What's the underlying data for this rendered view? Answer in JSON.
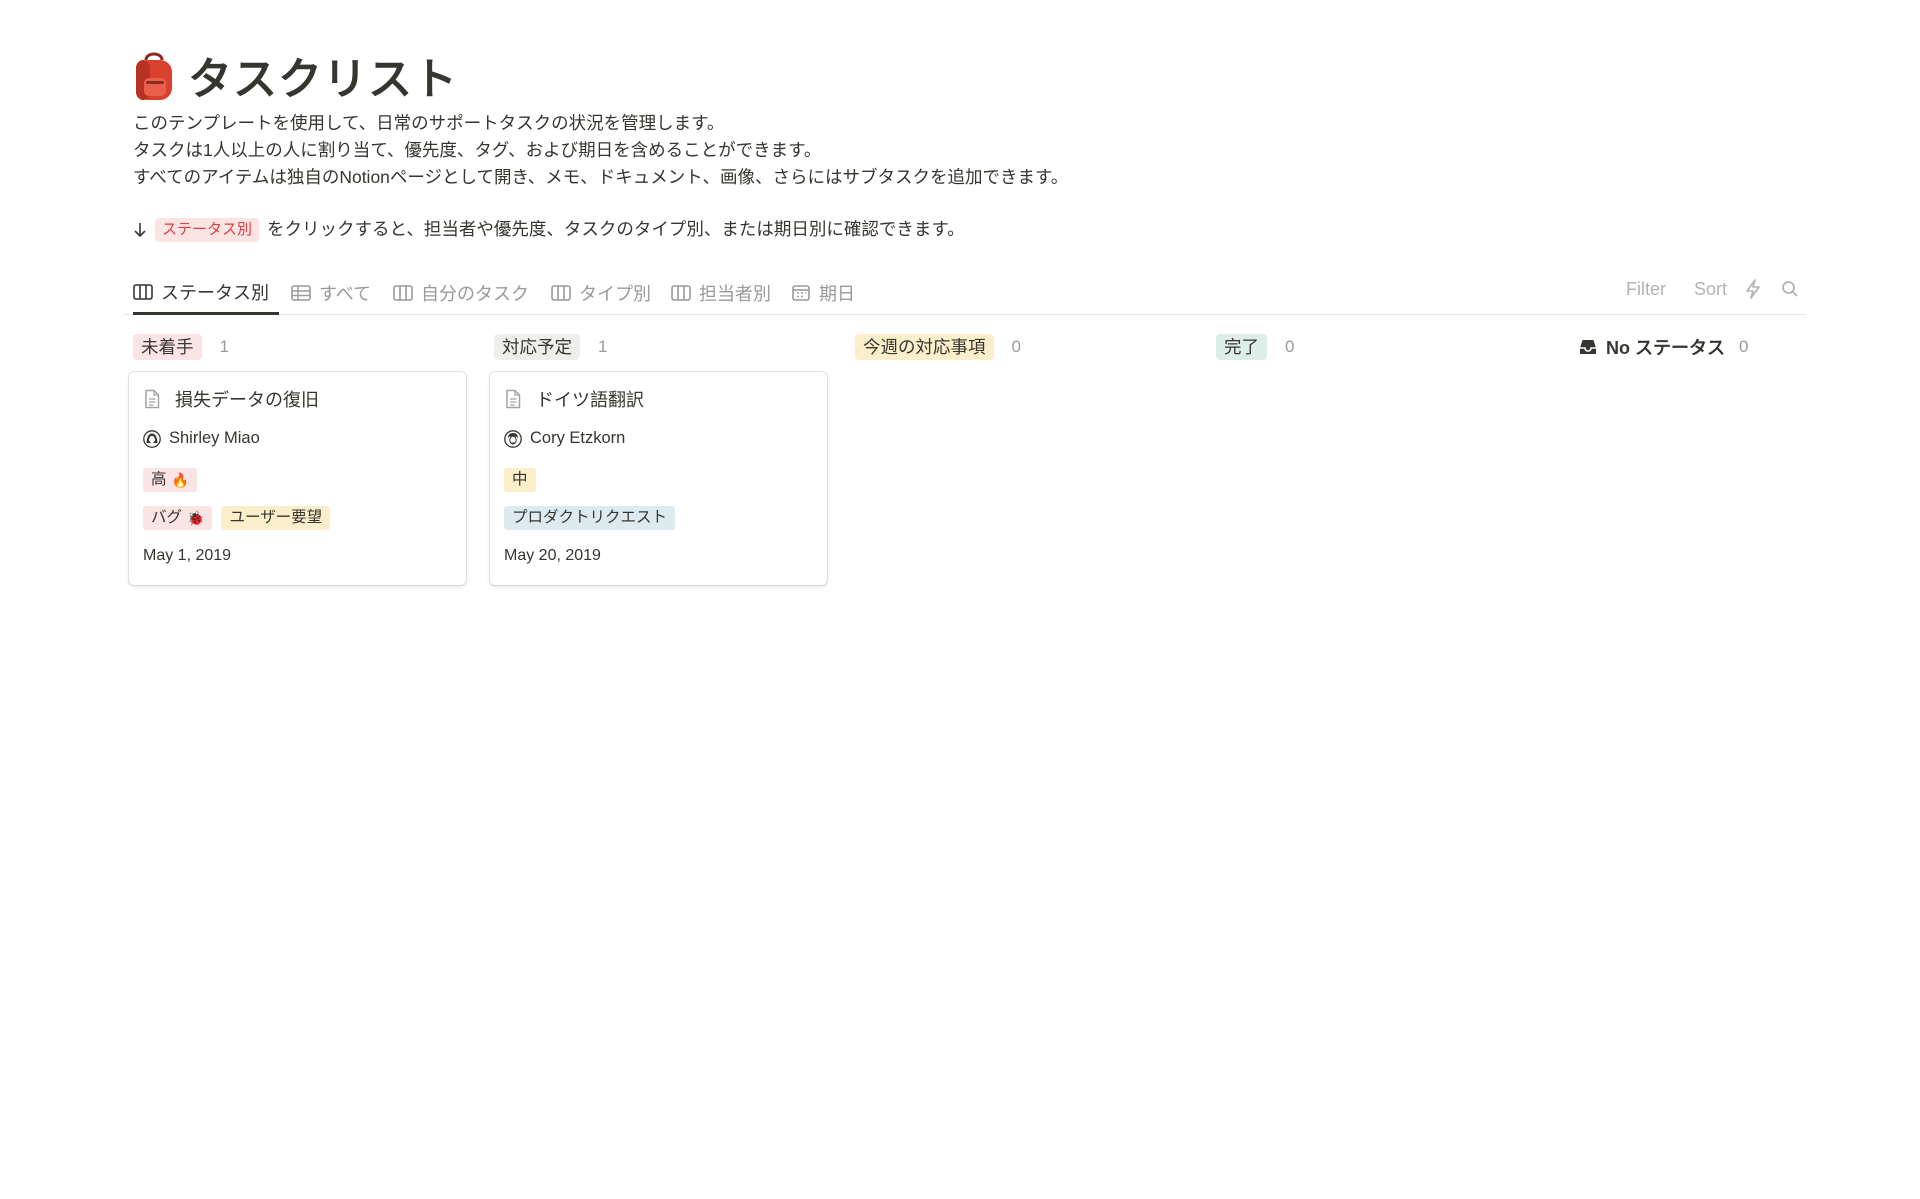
{
  "page": {
    "title": "タスクリスト",
    "icon": "backpack-icon",
    "description": [
      "このテンプレートを使用して、日常のサポートタスクの状況を管理します。",
      "タスクは1人以上の人に割り当て、優先度、タグ、および期日を含めることができます。",
      "すべてのアイテムは独自のNotionページとして開き、メモ、ドキュメント、画像、さらにはサブタスクを追加できます。"
    ],
    "hint": {
      "pill": "ステータス別",
      "text": "をクリックすると、担当者や優先度、タスクのタイプ別、または期日別に確認できます。"
    }
  },
  "tabs": [
    {
      "label": "ステータス別",
      "icon": "board-icon",
      "active": true
    },
    {
      "label": "すべて",
      "icon": "table-icon"
    },
    {
      "label": "自分のタスク",
      "icon": "board-icon"
    },
    {
      "label": "タイプ別",
      "icon": "board-icon"
    },
    {
      "label": "担当者別",
      "icon": "board-icon"
    },
    {
      "label": "期日",
      "icon": "calendar-icon"
    }
  ],
  "toolbar": {
    "filter": "Filter",
    "sort": "Sort"
  },
  "columns": [
    {
      "label": "未着手",
      "count": "1",
      "bg": "#fbe4e4",
      "color": "#37352f"
    },
    {
      "label": "対応予定",
      "count": "1",
      "bg": "#eeeeec",
      "color": "#37352f"
    },
    {
      "label": "今週の対応事項",
      "count": "0",
      "bg": "#fbeecb",
      "color": "#37352f"
    },
    {
      "label": "完了",
      "count": "0",
      "bg": "#ddedea",
      "color": "#37352f"
    },
    {
      "label": "No ステータス",
      "count": "0",
      "icon": "inbox-icon"
    }
  ],
  "cards": [
    {
      "title": "損失データの復旧",
      "assignee": "Shirley Miao",
      "priority": {
        "label": "高",
        "emoji": "🔥",
        "bg": "#fbe4e4"
      },
      "tags": [
        {
          "label": "バグ",
          "emoji": "🐞",
          "bg": "#fbe4e4"
        },
        {
          "label": "ユーザー要望",
          "bg": "#fbeecb"
        }
      ],
      "date": "May 1, 2019"
    },
    {
      "title": "ドイツ語翻訳",
      "assignee": "Cory Etzkorn",
      "priority": {
        "label": "中",
        "bg": "#fbeecb"
      },
      "tags": [
        {
          "label": "プロダクトリクエスト",
          "bg": "#ddebf1"
        }
      ],
      "date": "May 20, 2019"
    }
  ]
}
